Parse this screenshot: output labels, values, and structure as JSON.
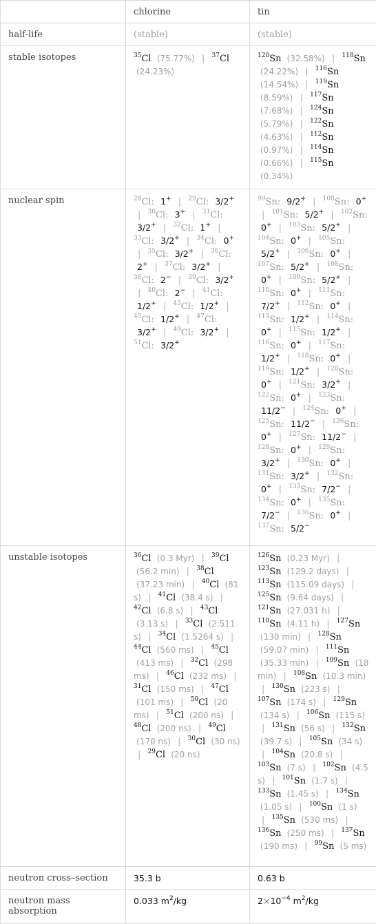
{
  "header": {
    "blank": "",
    "col1": "chlorine",
    "col2": "tin"
  },
  "rows": {
    "half_life": {
      "label": "half-life",
      "chlorine": "(stable)",
      "tin": "(stable)"
    },
    "stable_isotopes": {
      "label": "stable isotopes",
      "chlorine": [
        {
          "mass": "35",
          "sym": "Cl",
          "val": "(75.77%)"
        },
        {
          "mass": "37",
          "sym": "Cl",
          "val": "(24.23%)"
        }
      ],
      "tin": [
        {
          "mass": "120",
          "sym": "Sn",
          "val": "(32.58%)"
        },
        {
          "mass": "118",
          "sym": "Sn",
          "val": "(24.22%)"
        },
        {
          "mass": "116",
          "sym": "Sn",
          "val": "(14.54%)"
        },
        {
          "mass": "119",
          "sym": "Sn",
          "val": "(8.59%)"
        },
        {
          "mass": "117",
          "sym": "Sn",
          "val": "(7.68%)"
        },
        {
          "mass": "124",
          "sym": "Sn",
          "val": "(5.79%)"
        },
        {
          "mass": "122",
          "sym": "Sn",
          "val": "(4.63%)"
        },
        {
          "mass": "112",
          "sym": "Sn",
          "val": "(0.97%)"
        },
        {
          "mass": "114",
          "sym": "Sn",
          "val": "(0.66%)"
        },
        {
          "mass": "115",
          "sym": "Sn",
          "val": "(0.34%)"
        }
      ]
    },
    "nuclear_spin": {
      "label": "nuclear spin",
      "chlorine": [
        {
          "mass": "28",
          "sym": "Cl:",
          "spin": "1",
          "parity": "+"
        },
        {
          "mass": "29",
          "sym": "Cl:",
          "spin": "3/2",
          "parity": "+"
        },
        {
          "mass": "30",
          "sym": "Cl:",
          "spin": "3",
          "parity": "+"
        },
        {
          "mass": "31",
          "sym": "Cl:",
          "spin": "3/2",
          "parity": "+"
        },
        {
          "mass": "32",
          "sym": "Cl:",
          "spin": "1",
          "parity": "+"
        },
        {
          "mass": "33",
          "sym": "Cl:",
          "spin": "3/2",
          "parity": "+"
        },
        {
          "mass": "34",
          "sym": "Cl:",
          "spin": "0",
          "parity": "+"
        },
        {
          "mass": "35",
          "sym": "Cl:",
          "spin": "3/2",
          "parity": "+"
        },
        {
          "mass": "36",
          "sym": "Cl:",
          "spin": "2",
          "parity": "+"
        },
        {
          "mass": "37",
          "sym": "Cl:",
          "spin": "3/2",
          "parity": "+"
        },
        {
          "mass": "38",
          "sym": "Cl:",
          "spin": "2",
          "parity": "−"
        },
        {
          "mass": "39",
          "sym": "Cl:",
          "spin": "3/2",
          "parity": "+"
        },
        {
          "mass": "40",
          "sym": "Cl:",
          "spin": "2",
          "parity": "−"
        },
        {
          "mass": "41",
          "sym": "Cl:",
          "spin": "1/2",
          "parity": "+"
        },
        {
          "mass": "43",
          "sym": "Cl:",
          "spin": "1/2",
          "parity": "+"
        },
        {
          "mass": "45",
          "sym": "Cl:",
          "spin": "1/2",
          "parity": "+"
        },
        {
          "mass": "47",
          "sym": "Cl:",
          "spin": "3/2",
          "parity": "+"
        },
        {
          "mass": "49",
          "sym": "Cl:",
          "spin": "3/2",
          "parity": "+"
        },
        {
          "mass": "51",
          "sym": "Cl:",
          "spin": "3/2",
          "parity": "+"
        }
      ],
      "tin": [
        {
          "mass": "99",
          "sym": "Sn:",
          "spin": "9/2",
          "parity": "+"
        },
        {
          "mass": "100",
          "sym": "Sn:",
          "spin": "0",
          "parity": "+"
        },
        {
          "mass": "101",
          "sym": "Sn:",
          "spin": "5/2",
          "parity": "+"
        },
        {
          "mass": "102",
          "sym": "Sn:",
          "spin": "0",
          "parity": "+"
        },
        {
          "mass": "103",
          "sym": "Sn:",
          "spin": "5/2",
          "parity": "+"
        },
        {
          "mass": "104",
          "sym": "Sn:",
          "spin": "0",
          "parity": "+"
        },
        {
          "mass": "105",
          "sym": "Sn:",
          "spin": "5/2",
          "parity": "+"
        },
        {
          "mass": "106",
          "sym": "Sn:",
          "spin": "0",
          "parity": "+"
        },
        {
          "mass": "107",
          "sym": "Sn:",
          "spin": "5/2",
          "parity": "+"
        },
        {
          "mass": "108",
          "sym": "Sn:",
          "spin": "0",
          "parity": "+"
        },
        {
          "mass": "109",
          "sym": "Sn:",
          "spin": "5/2",
          "parity": "+"
        },
        {
          "mass": "110",
          "sym": "Sn:",
          "spin": "0",
          "parity": "+"
        },
        {
          "mass": "111",
          "sym": "Sn:",
          "spin": "7/2",
          "parity": "+"
        },
        {
          "mass": "112",
          "sym": "Sn:",
          "spin": "0",
          "parity": "+"
        },
        {
          "mass": "113",
          "sym": "Sn:",
          "spin": "1/2",
          "parity": "+"
        },
        {
          "mass": "114",
          "sym": "Sn:",
          "spin": "0",
          "parity": "+"
        },
        {
          "mass": "115",
          "sym": "Sn:",
          "spin": "1/2",
          "parity": "+"
        },
        {
          "mass": "116",
          "sym": "Sn:",
          "spin": "0",
          "parity": "+"
        },
        {
          "mass": "117",
          "sym": "Sn:",
          "spin": "1/2",
          "parity": "+"
        },
        {
          "mass": "118",
          "sym": "Sn:",
          "spin": "0",
          "parity": "+"
        },
        {
          "mass": "119",
          "sym": "Sn:",
          "spin": "1/2",
          "parity": "+"
        },
        {
          "mass": "120",
          "sym": "Sn:",
          "spin": "0",
          "parity": "+"
        },
        {
          "mass": "121",
          "sym": "Sn:",
          "spin": "3/2",
          "parity": "+"
        },
        {
          "mass": "122",
          "sym": "Sn:",
          "spin": "0",
          "parity": "+"
        },
        {
          "mass": "123",
          "sym": "Sn:",
          "spin": "11/2",
          "parity": "−"
        },
        {
          "mass": "124",
          "sym": "Sn:",
          "spin": "0",
          "parity": "+"
        },
        {
          "mass": "125",
          "sym": "Sn:",
          "spin": "11/2",
          "parity": "−"
        },
        {
          "mass": "126",
          "sym": "Sn:",
          "spin": "0",
          "parity": "+"
        },
        {
          "mass": "127",
          "sym": "Sn:",
          "spin": "11/2",
          "parity": "−"
        },
        {
          "mass": "128",
          "sym": "Sn:",
          "spin": "0",
          "parity": "+"
        },
        {
          "mass": "129",
          "sym": "Sn:",
          "spin": "3/2",
          "parity": "+"
        },
        {
          "mass": "130",
          "sym": "Sn:",
          "spin": "0",
          "parity": "+"
        },
        {
          "mass": "131",
          "sym": "Sn:",
          "spin": "3/2",
          "parity": "+"
        },
        {
          "mass": "132",
          "sym": "Sn:",
          "spin": "0",
          "parity": "+"
        },
        {
          "mass": "133",
          "sym": "Sn:",
          "spin": "7/2",
          "parity": "−"
        },
        {
          "mass": "134",
          "sym": "Sn:",
          "spin": "0",
          "parity": "+"
        },
        {
          "mass": "135",
          "sym": "Sn:",
          "spin": "7/2",
          "parity": "−"
        },
        {
          "mass": "136",
          "sym": "Sn:",
          "spin": "0",
          "parity": "+"
        },
        {
          "mass": "137",
          "sym": "Sn:",
          "spin": "5/2",
          "parity": "−"
        }
      ]
    },
    "unstable_isotopes": {
      "label": "unstable isotopes",
      "chlorine": [
        {
          "mass": "36",
          "sym": "Cl",
          "val": "(0.3 Myr)"
        },
        {
          "mass": "39",
          "sym": "Cl",
          "val": "(56.2 min)"
        },
        {
          "mass": "38",
          "sym": "Cl",
          "val": "(37.23 min)"
        },
        {
          "mass": "40",
          "sym": "Cl",
          "val": "(81 s)"
        },
        {
          "mass": "41",
          "sym": "Cl",
          "val": "(38.4 s)"
        },
        {
          "mass": "42",
          "sym": "Cl",
          "val": "(6.8 s)"
        },
        {
          "mass": "43",
          "sym": "Cl",
          "val": "(3.13 s)"
        },
        {
          "mass": "33",
          "sym": "Cl",
          "val": "(2.511 s)"
        },
        {
          "mass": "34",
          "sym": "Cl",
          "val": "(1.5264 s)"
        },
        {
          "mass": "44",
          "sym": "Cl",
          "val": "(560 ms)"
        },
        {
          "mass": "45",
          "sym": "Cl",
          "val": "(413 ms)"
        },
        {
          "mass": "32",
          "sym": "Cl",
          "val": "(298 ms)"
        },
        {
          "mass": "46",
          "sym": "Cl",
          "val": "(232 ms)"
        },
        {
          "mass": "31",
          "sym": "Cl",
          "val": "(150 ms)"
        },
        {
          "mass": "47",
          "sym": "Cl",
          "val": "(101 ms)"
        },
        {
          "mass": "50",
          "sym": "Cl",
          "val": "(20 ms)"
        },
        {
          "mass": "51",
          "sym": "Cl",
          "val": "(200 ns)"
        },
        {
          "mass": "48",
          "sym": "Cl",
          "val": "(200 ns)"
        },
        {
          "mass": "49",
          "sym": "Cl",
          "val": "(170 ns)"
        },
        {
          "mass": "30",
          "sym": "Cl",
          "val": "(30 ns)"
        },
        {
          "mass": "29",
          "sym": "Cl",
          "val": "(20 ns)"
        }
      ],
      "tin": [
        {
          "mass": "126",
          "sym": "Sn",
          "val": "(0.23 Myr)"
        },
        {
          "mass": "123",
          "sym": "Sn",
          "val": "(129.2 days)"
        },
        {
          "mass": "113",
          "sym": "Sn",
          "val": "(115.09 days)"
        },
        {
          "mass": "125",
          "sym": "Sn",
          "val": "(9.64 days)"
        },
        {
          "mass": "121",
          "sym": "Sn",
          "val": "(27.031 h)"
        },
        {
          "mass": "110",
          "sym": "Sn",
          "val": "(4.11 h)"
        },
        {
          "mass": "127",
          "sym": "Sn",
          "val": "(130 min)"
        },
        {
          "mass": "128",
          "sym": "Sn",
          "val": "(59.07 min)"
        },
        {
          "mass": "111",
          "sym": "Sn",
          "val": "(35.33 min)"
        },
        {
          "mass": "109",
          "sym": "Sn",
          "val": "(18 min)"
        },
        {
          "mass": "108",
          "sym": "Sn",
          "val": "(10.3 min)"
        },
        {
          "mass": "130",
          "sym": "Sn",
          "val": "(223 s)"
        },
        {
          "mass": "107",
          "sym": "Sn",
          "val": "(174 s)"
        },
        {
          "mass": "129",
          "sym": "Sn",
          "val": "(134 s)"
        },
        {
          "mass": "106",
          "sym": "Sn",
          "val": "(115 s)"
        },
        {
          "mass": "131",
          "sym": "Sn",
          "val": "(56 s)"
        },
        {
          "mass": "132",
          "sym": "Sn",
          "val": "(39.7 s)"
        },
        {
          "mass": "105",
          "sym": "Sn",
          "val": "(34 s)"
        },
        {
          "mass": "104",
          "sym": "Sn",
          "val": "(20.8 s)"
        },
        {
          "mass": "103",
          "sym": "Sn",
          "val": "(7 s)"
        },
        {
          "mass": "102",
          "sym": "Sn",
          "val": "(4.5 s)"
        },
        {
          "mass": "101",
          "sym": "Sn",
          "val": "(1.7 s)"
        },
        {
          "mass": "133",
          "sym": "Sn",
          "val": "(1.45 s)"
        },
        {
          "mass": "134",
          "sym": "Sn",
          "val": "(1.05 s)"
        },
        {
          "mass": "100",
          "sym": "Sn",
          "val": "(1 s)"
        },
        {
          "mass": "135",
          "sym": "Sn",
          "val": "(530 ms)"
        },
        {
          "mass": "136",
          "sym": "Sn",
          "val": "(250 ms)"
        },
        {
          "mass": "137",
          "sym": "Sn",
          "val": "(190 ms)"
        },
        {
          "mass": "99",
          "sym": "Sn",
          "val": "(5 ms)"
        }
      ]
    },
    "neutron_cross_section": {
      "label": "neutron cross–section",
      "chlorine": "35.3 b",
      "tin": "0.63 b"
    },
    "neutron_mass_absorption": {
      "label": "neutron mass absorption",
      "chlorine": {
        "value": "0.033",
        "unit_base": "m",
        "unit_exp": "2",
        "unit_tail": "/kg"
      },
      "tin": {
        "mantissa": "2",
        "times": "×",
        "base": "10",
        "exp": "−4",
        "unit_base": "m",
        "unit_exp": "2",
        "unit_tail": "/kg"
      }
    }
  }
}
